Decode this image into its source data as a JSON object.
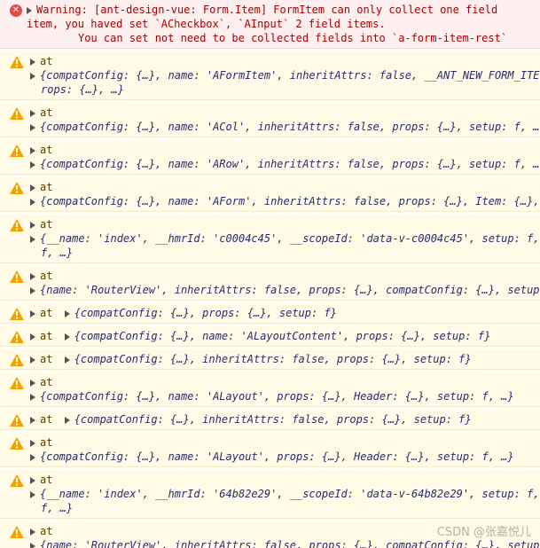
{
  "error": {
    "line1": "Warning: [ant-design-vue: Form.Item] FormItem can only collect one field",
    "line2": "item, you haved set `ACheckbox`, `AInput` 2 field items.",
    "line3": "You can set not need to be collected fields into `a-form-item-rest`"
  },
  "at_label": "at",
  "messages": [
    {
      "type": "two",
      "obj": "{compatConfig: {…}, name: 'AFormItem', inheritAttrs: false, __ANT_NEW_FORM_ITE",
      "cont": "rops: {…}, …}"
    },
    {
      "type": "two",
      "obj": "{compatConfig: {…}, name: 'ACol', inheritAttrs: false, props: {…}, setup: f, …"
    },
    {
      "type": "two",
      "obj": "{compatConfig: {…}, name: 'ARow', inheritAttrs: false, props: {…}, setup: f, …"
    },
    {
      "type": "two",
      "obj": "{compatConfig: {…}, name: 'AForm', inheritAttrs: false, props: {…}, Item: {…}, …"
    },
    {
      "type": "two",
      "obj": "{__name: 'index', __hmrId: 'c0004c45', __scopeId: 'data-v-c0004c45', setup: f,",
      "cont": "f, …}"
    },
    {
      "type": "two",
      "obj": "{name: 'RouterView', inheritAttrs: false, props: {…}, compatConfig: {…}, setup"
    },
    {
      "type": "one",
      "obj": "{compatConfig: {…}, props: {…}, setup: f}"
    },
    {
      "type": "one",
      "obj": "{compatConfig: {…}, name: 'ALayoutContent', props: {…}, setup: f}"
    },
    {
      "type": "one",
      "obj": "{compatConfig: {…}, inheritAttrs: false, props: {…}, setup: f}"
    },
    {
      "type": "two",
      "obj": "{compatConfig: {…}, name: 'ALayout', props: {…}, Header: {…}, setup: f, …}"
    },
    {
      "type": "one",
      "obj": "{compatConfig: {…}, inheritAttrs: false, props: {…}, setup: f}"
    },
    {
      "type": "two",
      "obj": "{compatConfig: {…}, name: 'ALayout', props: {…}, Header: {…}, setup: f, …}"
    },
    {
      "type": "two",
      "obj": "{__name: 'index', __hmrId: '64b82e29', __scopeId: 'data-v-64b82e29', setup: f,",
      "cont": "f, …}"
    },
    {
      "type": "two",
      "obj": "{name: 'RouterView', inheritAttrs: false, props: {…}, compatConfig: {…}, setup"
    }
  ],
  "watermark": "CSDN @张嘉悦儿",
  "colors": {
    "warn_bg": "#fffbe6",
    "error_bg": "#fff0f0",
    "error_icon": "#e34a4a",
    "warn_icon": "#f2a100"
  }
}
